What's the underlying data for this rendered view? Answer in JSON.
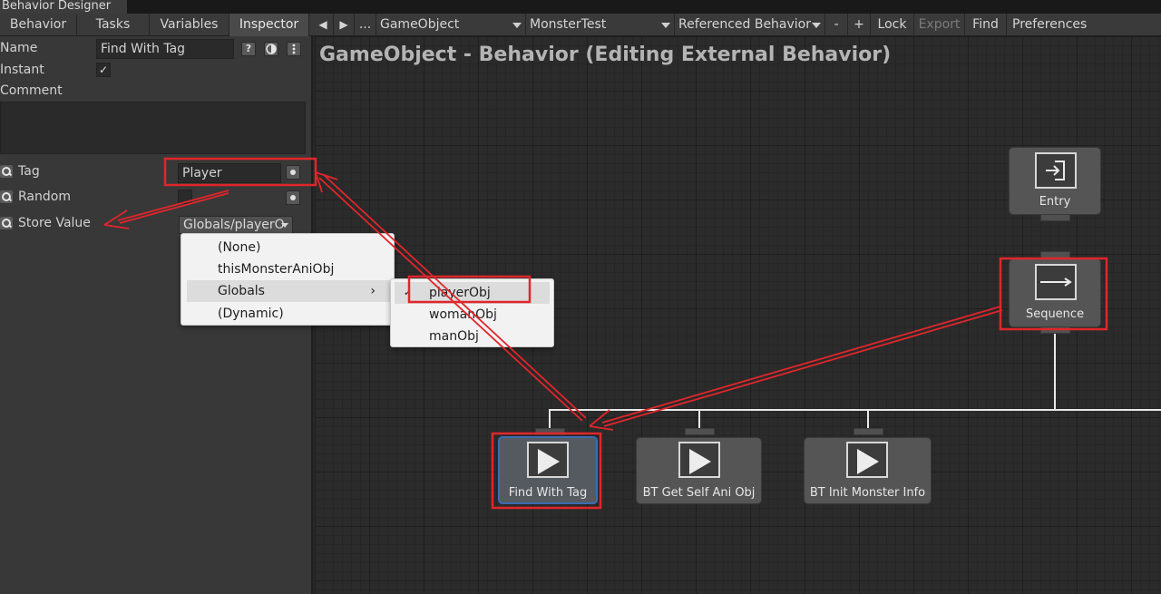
{
  "window": {
    "title": "Behavior Designer"
  },
  "toolbar": {
    "tabs": [
      "Behavior",
      "Tasks",
      "Variables",
      "Inspector"
    ],
    "nav_back": "◀",
    "nav_forward": "▶",
    "ellipsis": "...",
    "object_dropdown": "GameObject",
    "behavior_dropdown": "MonsterTest",
    "referenced_dropdown": "Referenced Behavior",
    "minus": "-",
    "plus": "+",
    "lock": "Lock",
    "export": "Export",
    "find": "Find",
    "preferences": "Preferences"
  },
  "inspector": {
    "name_label": "Name",
    "name_value": "Find With Tag",
    "help_glyph": "?",
    "instant_label": "Instant",
    "instant_check": "✓",
    "comment_label": "Comment",
    "tag_label": "Tag",
    "tag_value": "Player",
    "random_label": "Random",
    "store_label": "Store Value",
    "store_value": "Globals/playerO"
  },
  "menu": {
    "items": [
      "(None)",
      "thisMonsterAniObj",
      "Globals",
      "(Dynamic)"
    ],
    "submenu_arrow": "›"
  },
  "submenu": {
    "check": "✓",
    "items": [
      "playerObj",
      "womanObj",
      "manObj"
    ]
  },
  "graph": {
    "title": "GameObject - Behavior (Editing External Behavior)",
    "nodes": {
      "entry": "Entry",
      "sequence": "Sequence",
      "find": "Find With Tag",
      "get_self": "BT   Get Self Ani Obj",
      "init_monster": "BT   Init Monster Info"
    }
  },
  "colors": {
    "annotation": "#e0262b",
    "selection": "#3b6db3"
  }
}
